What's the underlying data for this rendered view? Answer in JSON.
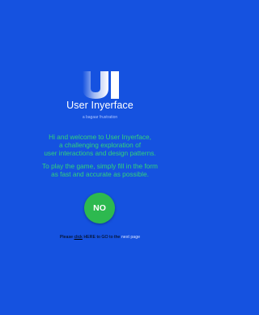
{
  "logo": {
    "letters": "UI"
  },
  "app_title": "User Inyerface",
  "tagline": "a bagaar frustration",
  "intro": {
    "paragraph1": [
      "Hi and welcome to User Inyerface,",
      "a challenging exploration of",
      "user interactions and design patterns."
    ],
    "paragraph2": [
      "To play the game, simply fill in the form",
      "as fast and accurate as possible."
    ]
  },
  "no_button_label": "NO",
  "footer": {
    "please": "Please",
    "click": "click",
    "here_to_go": "HERE to GO to the",
    "next_page": "next page"
  },
  "colors": {
    "background": "#1552e0",
    "accent_green": "#31d27a",
    "button_green": "#2db94f",
    "tagline": "#a9c2ff"
  }
}
